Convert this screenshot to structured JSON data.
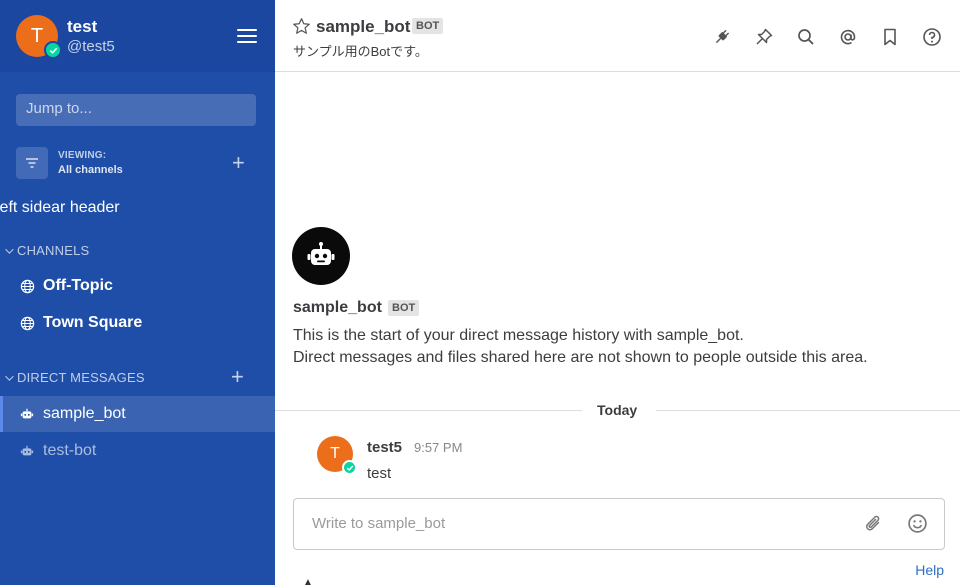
{
  "user": {
    "display_name": "test",
    "handle": "@test5",
    "avatar_letter": "T"
  },
  "sidebar": {
    "jump_placeholder": "Jump to...",
    "viewing_label": "VIEWING:",
    "viewing_value": "All channels",
    "custom_header": "left sidear header",
    "channels_title": "CHANNELS",
    "channels": [
      {
        "label": "Off-Topic",
        "icon": "globe-icon"
      },
      {
        "label": "Town Square",
        "icon": "globe-icon"
      }
    ],
    "dm_title": "DIRECT MESSAGES",
    "dms": [
      {
        "label": "sample_bot",
        "icon": "bot-icon",
        "active": true
      },
      {
        "label": "test-bot",
        "icon": "bot-icon",
        "active": false
      }
    ]
  },
  "channel": {
    "name": "sample_bot",
    "tag": "BOT",
    "description": "サンプル用のBotです。",
    "header_icons": [
      "plugin-icon",
      "pin-icon",
      "search-icon",
      "mention-icon",
      "bookmark-icon",
      "help-icon"
    ]
  },
  "intro": {
    "name": "sample_bot",
    "tag": "BOT",
    "line1": "This is the start of your direct message history with sample_bot.",
    "line2": "Direct messages and files shared here are not shown to people outside this area."
  },
  "date_separator": "Today",
  "message": {
    "user": "test5",
    "time": "9:57 PM",
    "text": "test",
    "avatar_letter": "T"
  },
  "composer": {
    "placeholder": "Write to sample_bot"
  },
  "help_link": "Help",
  "colors": {
    "sidebar": "#1f4ea8",
    "sidebar_header": "#1b47a0",
    "avatar": "#ec6e1b",
    "online": "#06d6a0",
    "link": "#2a6fc9"
  }
}
